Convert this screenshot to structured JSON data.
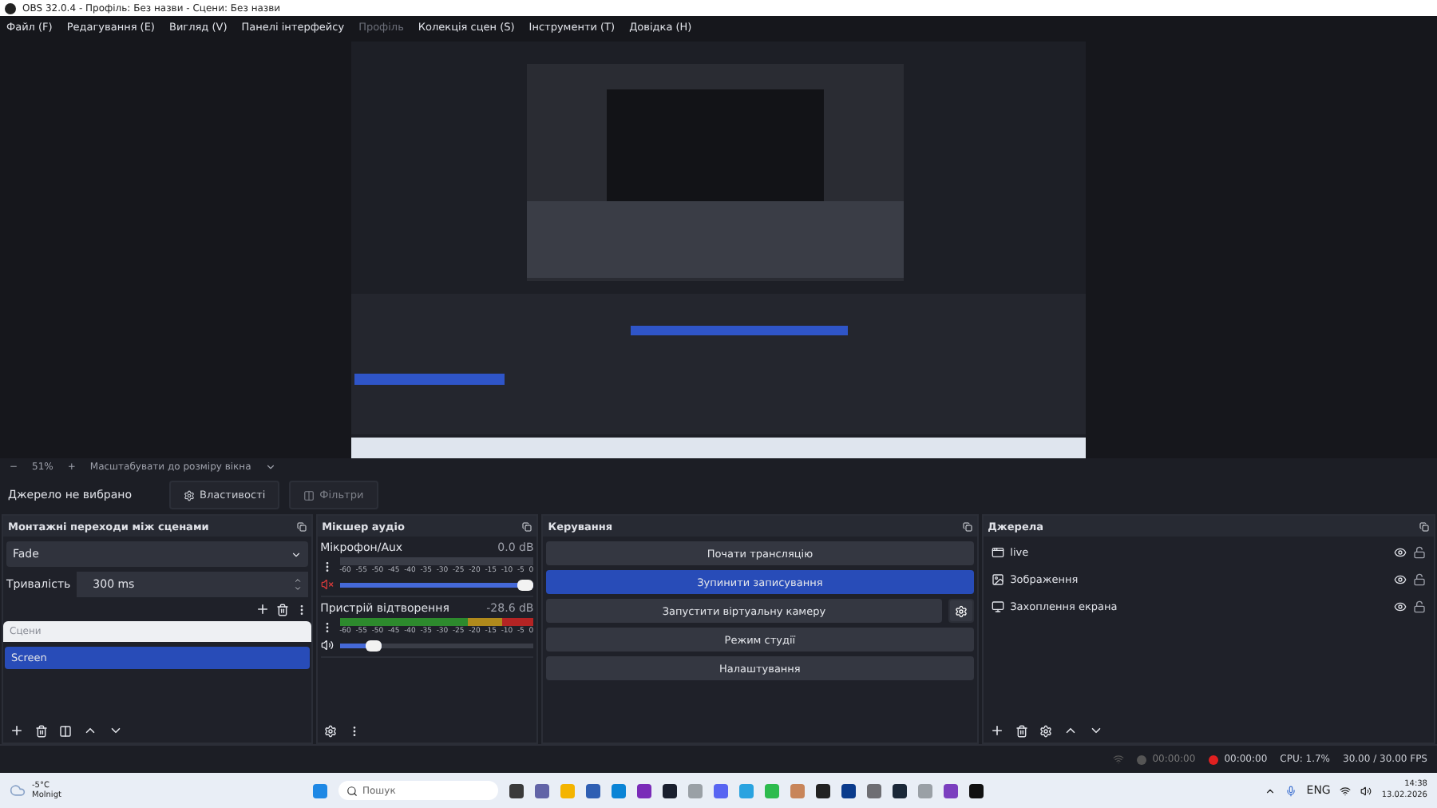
{
  "window": {
    "title": "OBS 32.0.4 - Профіль: Без назви - Сцени: Без назви"
  },
  "menu": [
    {
      "label": "Файл (F)",
      "disabled": false
    },
    {
      "label": "Редагування (E)",
      "disabled": false
    },
    {
      "label": "Вигляд (V)",
      "disabled": false
    },
    {
      "label": "Панелі інтерфейсу",
      "disabled": false
    },
    {
      "label": "Профіль",
      "disabled": true
    },
    {
      "label": "Колекція сцен (S)",
      "disabled": false
    },
    {
      "label": "Інструменти (T)",
      "disabled": false
    },
    {
      "label": "Довідка (H)",
      "disabled": false
    }
  ],
  "zoom_bar": {
    "minus": "−",
    "percent": "51%",
    "plus": "+",
    "mode": "Масштабувати до розміру вікна"
  },
  "source_bar": {
    "status": "Джерело не вибрано",
    "properties": "Властивості",
    "filters": "Фільтри"
  },
  "transitions": {
    "title": "Монтажні переходи між сценами",
    "transition": "Fade",
    "duration_label": "Тривалість",
    "duration": "300 ms"
  },
  "scenes": {
    "header": "Сцени",
    "items": [
      {
        "label": "Screen",
        "selected": true
      }
    ]
  },
  "mixer": {
    "title": "Мікшер аудіо",
    "channels": [
      {
        "name": "Мікрофон/Aux",
        "reading": "0.0 dB",
        "muted": true,
        "meter_active": false,
        "level": 1,
        "scale": [
          "-60",
          "-55",
          "-50",
          "-45",
          "-40",
          "-35",
          "-30",
          "-25",
          "-20",
          "-15",
          "-10",
          "-5",
          "0"
        ]
      },
      {
        "name": "Пристрій відтворення",
        "reading": "-28.6 dB",
        "muted": false,
        "meter_active": true,
        "level": 0.22,
        "scale": [
          "-60",
          "-55",
          "-50",
          "-45",
          "-40",
          "-35",
          "-30",
          "-25",
          "-20",
          "-15",
          "-10",
          "-5",
          "0"
        ]
      }
    ]
  },
  "controls": {
    "title": "Керування",
    "buttons": [
      {
        "label": "Почати трансляцію",
        "active": false,
        "has_settings": false
      },
      {
        "label": "Зупинити записування",
        "active": true,
        "has_settings": false
      },
      {
        "label": "Запустити віртуальну камеру",
        "active": false,
        "has_settings": true
      },
      {
        "label": "Режим студії",
        "active": false,
        "has_settings": false
      },
      {
        "label": "Налаштування",
        "active": false,
        "has_settings": false
      }
    ]
  },
  "sources": {
    "title": "Джерела",
    "items": [
      {
        "label": "live",
        "kind": "window",
        "visible": true,
        "locked": false
      },
      {
        "label": "Зображення",
        "kind": "image",
        "visible": true,
        "locked": false
      },
      {
        "label": "Захоплення екрана",
        "kind": "display",
        "visible": true,
        "locked": false
      }
    ]
  },
  "status_bar": {
    "stream_time": "00:00:00",
    "record_time": "00:00:00",
    "cpu": "CPU: 1.7%",
    "fps": "30.00 / 30.00 FPS"
  },
  "taskbar": {
    "temperature": "-5°C",
    "weather": "Molnigt",
    "search_placeholder": "Пошук",
    "language": "ENG",
    "time": "14:38",
    "date": "13.02.2026"
  }
}
